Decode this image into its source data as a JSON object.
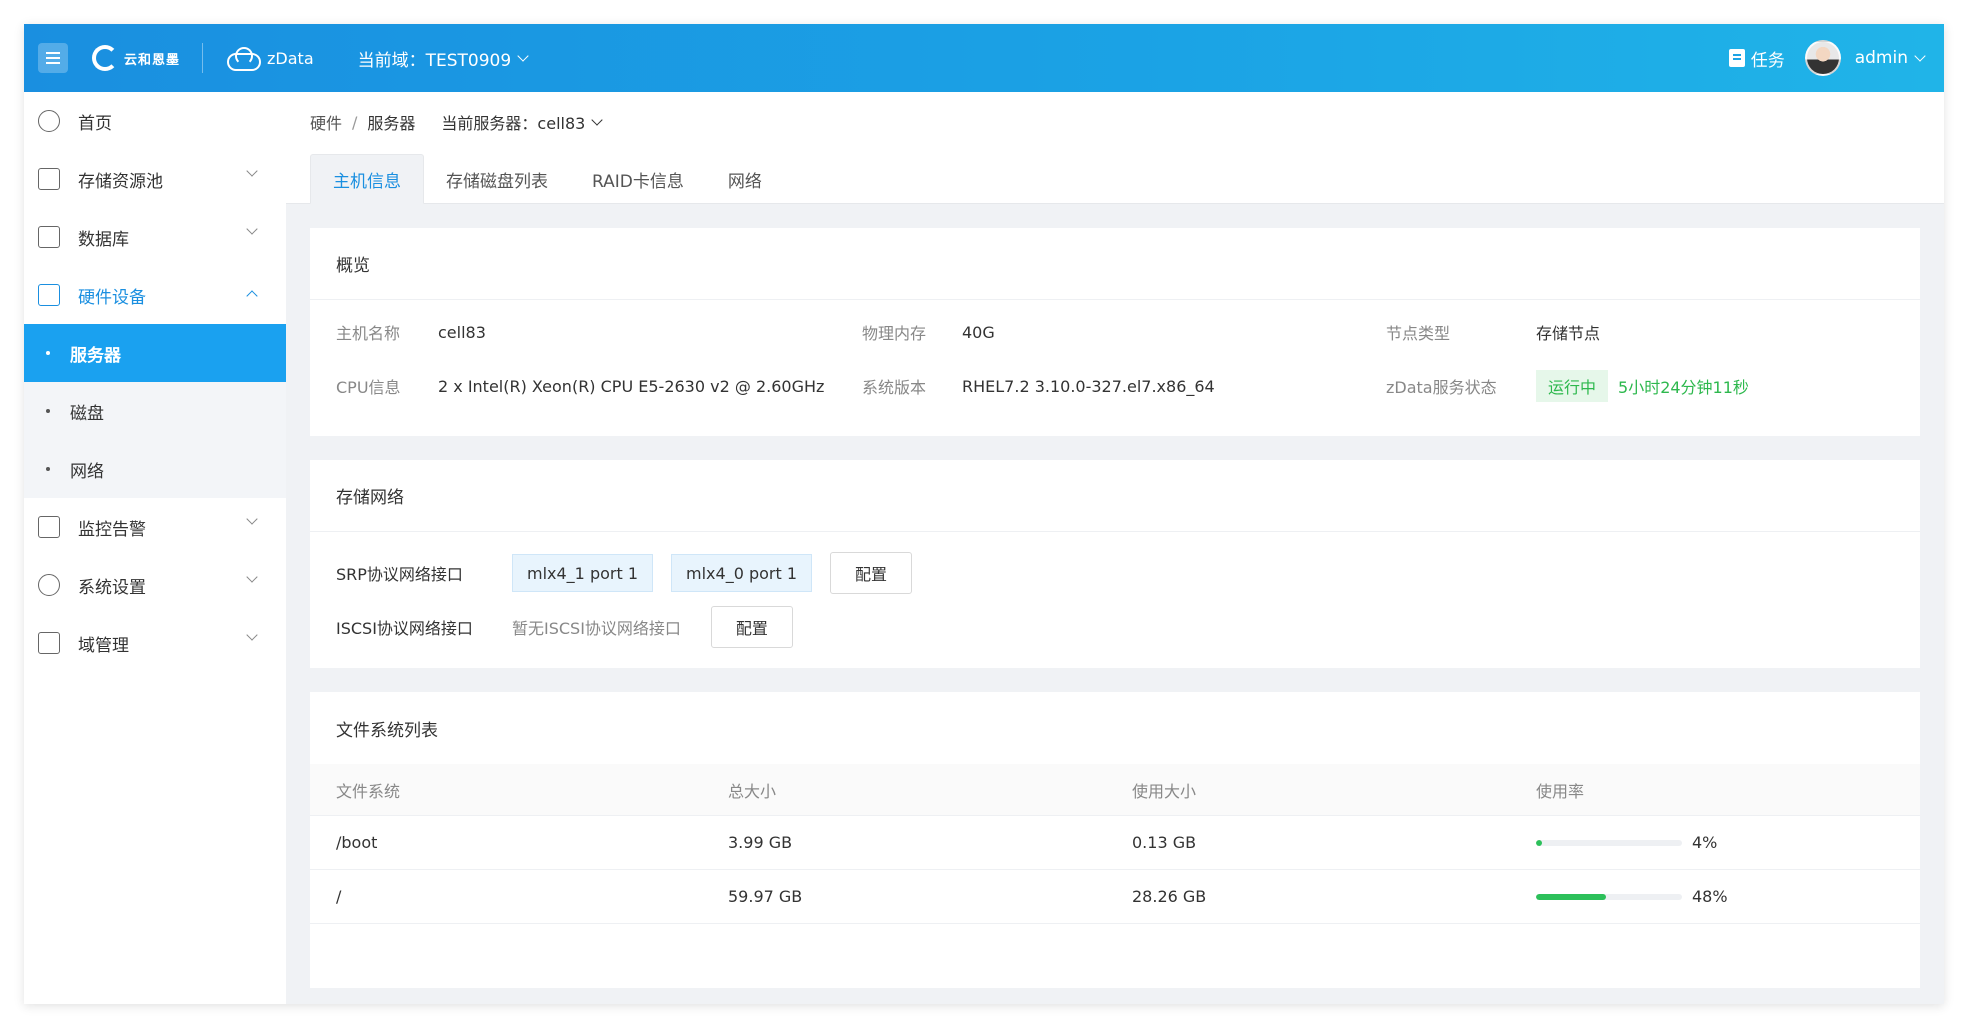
{
  "topbar": {
    "brand_text": "云和恩墨",
    "product_name": "zData",
    "domain_label": "当前域：TEST0909",
    "task_label": "任务",
    "user_name": "admin"
  },
  "sidebar": {
    "items": [
      {
        "label": "首页",
        "icon": "home-icon",
        "has_chevron": false
      },
      {
        "label": "存储资源池",
        "icon": "storage-pool-icon",
        "has_chevron": true
      },
      {
        "label": "数据库",
        "icon": "database-icon",
        "has_chevron": true
      },
      {
        "label": "硬件设备",
        "icon": "hardware-icon",
        "has_chevron": true,
        "open": true
      },
      {
        "label": "监控告警",
        "icon": "monitor-icon",
        "has_chevron": true
      },
      {
        "label": "系统设置",
        "icon": "settings-icon",
        "has_chevron": true
      },
      {
        "label": "域管理",
        "icon": "domain-icon",
        "has_chevron": true
      }
    ],
    "sub_items": [
      {
        "label": "服务器",
        "active": true
      },
      {
        "label": "磁盘",
        "active": false
      },
      {
        "label": "网络",
        "active": false
      }
    ]
  },
  "breadcrumb": {
    "items": [
      "硬件",
      "服务器"
    ],
    "separator": "/",
    "current_server": "当前服务器：cell83"
  },
  "tabs": [
    "主机信息",
    "存储磁盘列表",
    "RAID卡信息",
    "网络"
  ],
  "overview": {
    "title": "概览",
    "host_name_label": "主机名称",
    "host_name": "cell83",
    "memory_label": "物理内存",
    "memory": "40G",
    "node_type_label": "节点类型",
    "node_type": "存储节点",
    "cpu_label": "CPU信息",
    "cpu": "2 x Intel(R) Xeon(R) CPU E5-2630 v2 @ 2.60GHz",
    "os_label": "系统版本",
    "os": "RHEL7.2 3.10.0-327.el7.x86_64",
    "service_label": "zData服务状态",
    "service_status": "运行中",
    "uptime": "5小时24分钟11秒",
    "status_color": "#2db84d"
  },
  "storage_network": {
    "title": "存储网络",
    "srp_label": "SRP协议网络接口",
    "srp_ports": [
      "mlx4_1 port 1",
      "mlx4_0 port 1"
    ],
    "iscsi_label": "ISCSI协议网络接口",
    "iscsi_empty": "暂无ISCSI协议网络接口",
    "config_label": "配置"
  },
  "filesystems": {
    "title": "文件系统列表",
    "columns": [
      "文件系统",
      "总大小",
      "使用大小",
      "使用率"
    ],
    "rows": [
      {
        "fs": "/boot",
        "total": "3.99 GB",
        "used": "0.13 GB",
        "usage_text": "4%",
        "usage": 4
      },
      {
        "fs": "/",
        "total": "59.97 GB",
        "used": "28.26 GB",
        "usage_text": "48%",
        "usage": 48
      }
    ],
    "bar_color": "#2cc05a"
  },
  "colors": {
    "accent": "#1a8fe0",
    "active_item": "#1aa1f0"
  }
}
